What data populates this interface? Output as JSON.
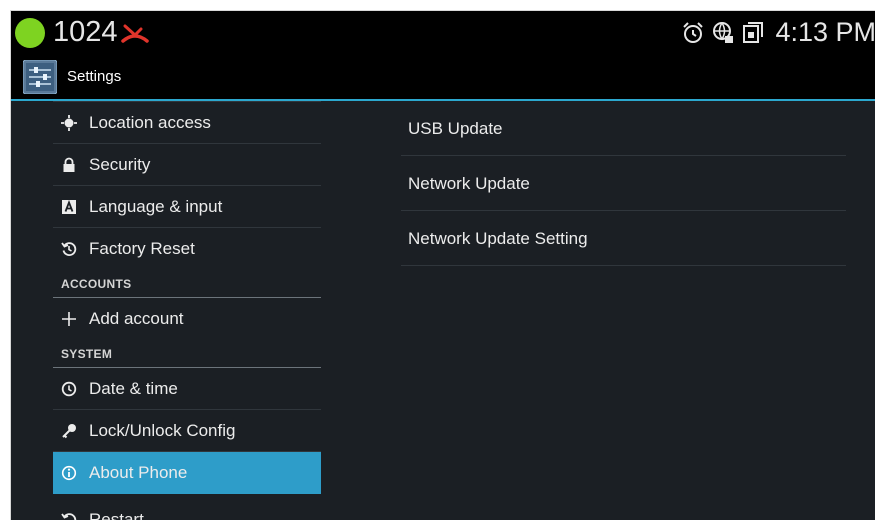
{
  "status_bar": {
    "extension": "1024",
    "time": "4:13 PM",
    "icons": [
      "account-online-icon",
      "missed-call-icon",
      "alarm-icon",
      "network-globe-icon",
      "screen-rotation-icon"
    ],
    "colors": {
      "online": "#7ed321",
      "missed": "#e0342b"
    }
  },
  "action_bar": {
    "title": "Settings",
    "icon": "settings-app-icon",
    "accent": "#2ca8cf"
  },
  "menu": {
    "items": [
      {
        "label": "Location access",
        "icon": "location-icon"
      },
      {
        "label": "Security",
        "icon": "lock-icon"
      },
      {
        "label": "Language & input",
        "icon": "keyboard-icon"
      },
      {
        "label": "Factory Reset",
        "icon": "factory-reset-icon"
      },
      {
        "header": "ACCOUNTS"
      },
      {
        "label": "Add account",
        "icon": "add-icon"
      },
      {
        "header": "SYSTEM"
      },
      {
        "label": "Date & time",
        "icon": "clock-icon"
      },
      {
        "label": "Lock/Unlock Config",
        "icon": "key-icon"
      },
      {
        "label": "About Phone",
        "icon": "info-icon",
        "selected": true
      },
      {
        "label": "Restart",
        "icon": "restart-icon"
      }
    ],
    "selected_color": "#2e9dc9"
  },
  "detail": {
    "items": [
      {
        "label": "USB Update"
      },
      {
        "label": "Network Update"
      },
      {
        "label": "Network Update Setting"
      }
    ]
  }
}
